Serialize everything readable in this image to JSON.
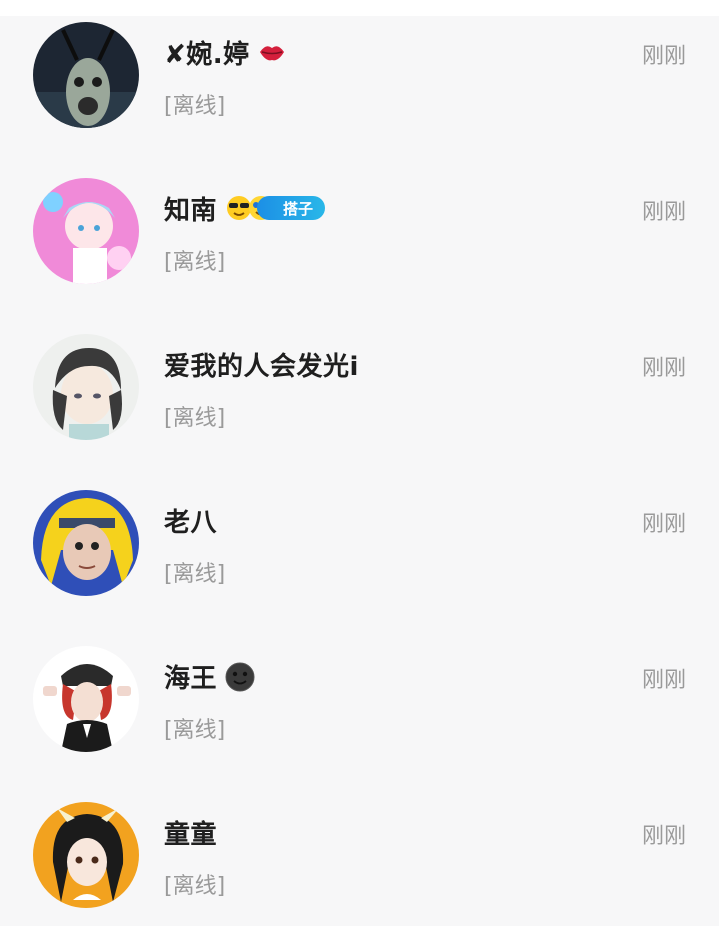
{
  "contacts": [
    {
      "name": "✘婉.婷",
      "status": "[离线]",
      "time": "刚刚",
      "emoji": "lips-emoji"
    },
    {
      "name": "知南",
      "status": "[离线]",
      "time": "刚刚",
      "badge": "搭子",
      "emoji": "sunglasses-emoji"
    },
    {
      "name": "爱我的人会发光i",
      "status": "[离线]",
      "time": "刚刚"
    },
    {
      "name": "老八",
      "status": "[离线]",
      "time": "刚刚"
    },
    {
      "name": "海王",
      "status": "[离线]",
      "time": "刚刚",
      "emoji": "dark-moon-face-emoji"
    },
    {
      "name": "童童",
      "status": "[离线]",
      "time": "刚刚"
    }
  ],
  "colors": {
    "background": "#f7f7f8",
    "name": "#1f1f1f",
    "muted": "#9a9a9a",
    "badge": "#1c8fe6"
  }
}
